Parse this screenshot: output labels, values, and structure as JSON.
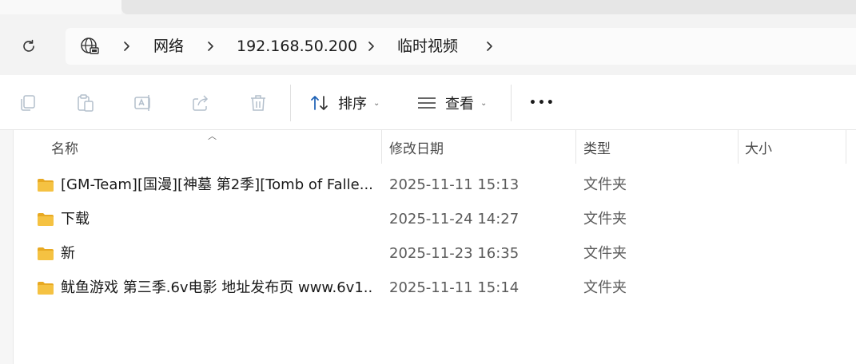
{
  "address": {
    "location_icon": "network-globe-icon",
    "crumbs": [
      "网络",
      "192.168.50.200",
      "临时视频"
    ]
  },
  "commands": {
    "sort_label": "排序",
    "view_label": "查看",
    "more_label": "•••"
  },
  "columns": {
    "name": "名称",
    "modified": "修改日期",
    "type": "类型",
    "size": "大小"
  },
  "files": [
    {
      "name": "[GM-Team][国漫][神墓 第2季][Tomb of Falle...",
      "modified": "2025-11-11 15:13",
      "type": "文件夹",
      "size": ""
    },
    {
      "name": "下载",
      "modified": "2025-11-24 14:27",
      "type": "文件夹",
      "size": ""
    },
    {
      "name": "新",
      "modified": "2025-11-23 16:35",
      "type": "文件夹",
      "size": ""
    },
    {
      "name": "鱿鱼游戏 第三季.6v电影 地址发布页 www.6v1...",
      "modified": "2025-11-11 15:14",
      "type": "文件夹",
      "size": ""
    }
  ],
  "colors": {
    "folder": "#f5c242",
    "folder_dark": "#e8a922",
    "accent": "#1a5fb4"
  }
}
